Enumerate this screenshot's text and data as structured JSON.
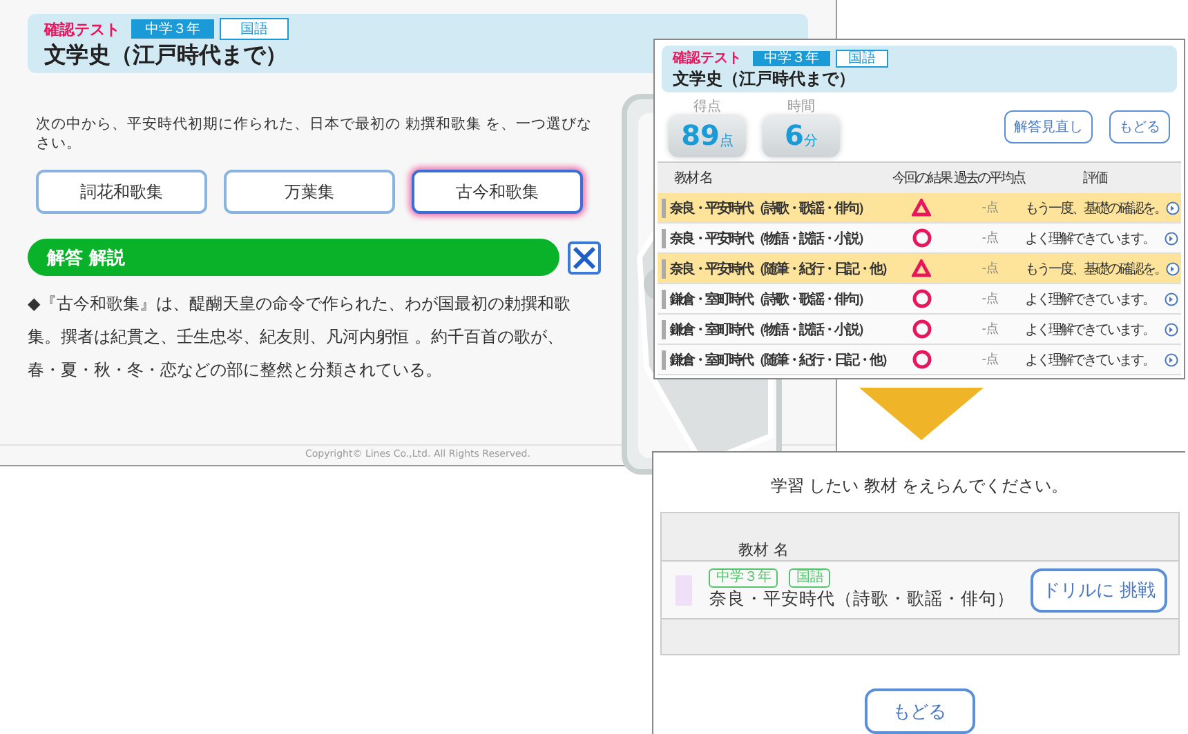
{
  "quiz_screen": {
    "test_label": "確認テスト",
    "grade_tag": "中学３年",
    "subject_tag": "国語",
    "title": "文学史（江戸時代まで）",
    "question": "次の中から、平安時代初期に作られた、日本で最初の 勅撰和歌集 を、一つ選びなさい。",
    "choices": [
      {
        "label": "詞花和歌集",
        "selected": false
      },
      {
        "label": "万葉集",
        "selected": false
      },
      {
        "label": "古今和歌集",
        "selected": true
      }
    ],
    "explanation_title": "解答 解説",
    "explanation": "◆『古今和歌集』は、醍醐天皇の命令で作られた、わが国最初の勅撰和歌集。撰者は紀貫之、壬生忠岑、紀友則、凡河内躬恒 。約千百首の歌が、春・夏・秋・冬・恋などの部に整然と分類されている。",
    "copyright": "Copyright© Lines Co.,Ltd. All Rights Reserved."
  },
  "results_screen": {
    "test_label": "確認テスト",
    "grade_tag": "中学３年",
    "subject_tag": "国語",
    "title": "文学史（江戸時代まで）",
    "score_label": "得点",
    "score": "89",
    "score_unit": "点",
    "time_label": "時間",
    "time": "6",
    "time_unit": "分",
    "buttons": [
      "解答見直し",
      "もどる"
    ],
    "columns": [
      "教材 名",
      "今回の結果",
      "過去の平均点",
      "評価"
    ],
    "rows": [
      {
        "name": "奈良・平安時代（詩歌・歌謡・俳句）",
        "kind": "triangle",
        "average": "- 点",
        "comment": "もう一度、基礎の確認を。",
        "highlighted": true
      },
      {
        "name": "奈良・平安時代（物語・説話・小説）",
        "kind": "circle",
        "average": "- 点",
        "comment": "よく理解できています。",
        "highlighted": false
      },
      {
        "name": "奈良・平安時代（随筆・紀行・日記・他）",
        "kind": "triangle",
        "average": "- 点",
        "comment": "もう一度、基礎の確認を。",
        "highlighted": true
      },
      {
        "name": "鎌倉・室町時代（詩歌・歌謡・俳句）",
        "kind": "circle",
        "average": "- 点",
        "comment": "よく理解できています。",
        "highlighted": false
      },
      {
        "name": "鎌倉・室町時代（物語・説話・小説）",
        "kind": "circle",
        "average": "- 点",
        "comment": "よく理解できています。",
        "highlighted": false
      },
      {
        "name": "鎌倉・室町時代（随筆・紀行・日記・他）",
        "kind": "circle",
        "average": "- 点",
        "comment": "よく理解できています。",
        "highlighted": false
      }
    ]
  },
  "selection_screen": {
    "instruction": "学習 したい 教材 をえらんでください。",
    "column": "教材 名",
    "row": {
      "grade_tag": "中学３年",
      "subject_tag": "国語",
      "name": "奈良・平安時代（詩歌・歌謡・俳句）",
      "button": "ドリルに 挑戦"
    },
    "back_button": "もどる"
  }
}
